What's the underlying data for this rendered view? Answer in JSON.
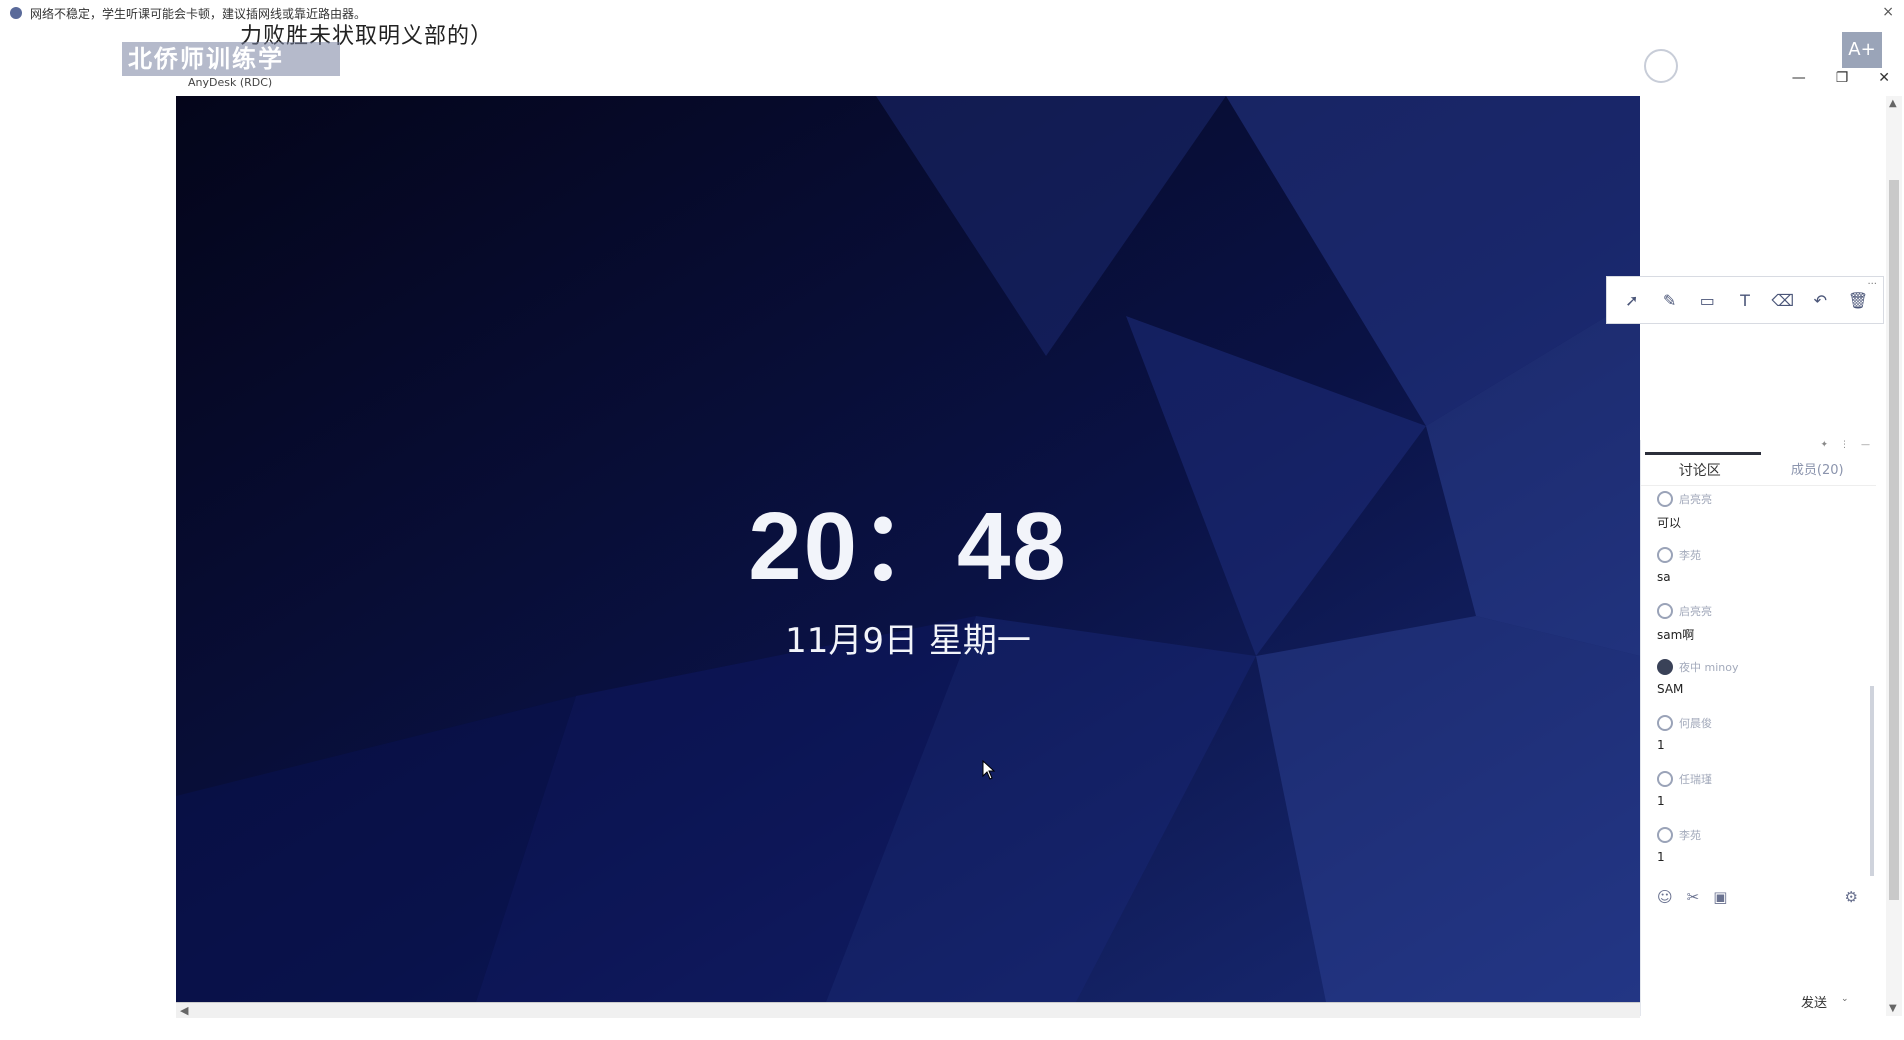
{
  "warning_bar": {
    "text": "网络不稳定，学生听课可能会卡顿，建议插网线或靠近路由器。",
    "close": "×"
  },
  "header": {
    "course_title": "力败胜未状取明义部的）",
    "watermark": "北侨师训练学",
    "rdp_label": "AnyDesk (RDC)",
    "avatar_label": "A+"
  },
  "window_controls": {
    "minimize": "—",
    "restore": "❐",
    "close": "✕"
  },
  "lock_screen": {
    "time": "20：48",
    "date": "11月9日 星期一"
  },
  "annotation_toolbar": {
    "more": "···",
    "tools": [
      {
        "name": "select-tool-icon",
        "glyph": "➚"
      },
      {
        "name": "pen-tool-icon",
        "glyph": "✎"
      },
      {
        "name": "shape-tool-icon",
        "glyph": "▭"
      },
      {
        "name": "text-tool-icon",
        "glyph": "T"
      },
      {
        "name": "eraser-tool-icon",
        "glyph": "⌫"
      },
      {
        "name": "undo-tool-icon",
        "glyph": "↶"
      },
      {
        "name": "trash-tool-icon",
        "glyph": "🗑"
      }
    ]
  },
  "chat": {
    "tabs": {
      "discussion": "讨论区",
      "members": "成员(20)"
    },
    "messages": [
      {
        "name": "启亮亮",
        "body": "可以",
        "dark": false
      },
      {
        "name": "李苑",
        "body": "sa",
        "dark": false
      },
      {
        "name": "启亮亮",
        "body": "sam啊",
        "dark": false
      },
      {
        "name": "夜中 minoy",
        "body": "SAM",
        "dark": true
      },
      {
        "name": "何晨俊",
        "body": "1",
        "dark": false
      },
      {
        "name": "任瑞瑾",
        "body": "1",
        "dark": false
      },
      {
        "name": "李苑",
        "body": "1",
        "dark": false
      }
    ],
    "send_label": "发送"
  }
}
